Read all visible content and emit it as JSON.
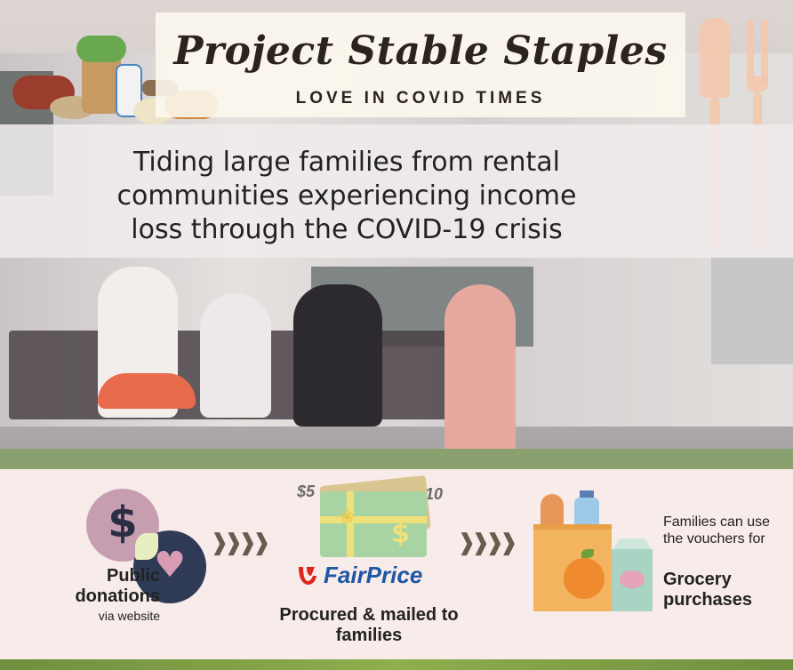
{
  "title": {
    "main": "Project Stable Staples",
    "subtitle": "LOVE IN COVID TIMES"
  },
  "description": "Tiding large families from rental communities experiencing income loss through the COVID-19 crisis",
  "steps": {
    "donation": {
      "label": "Public donations",
      "sublabel": "via website",
      "icons": [
        "dollar-coin-icon",
        "heart-coin-icon"
      ]
    },
    "voucher": {
      "amount_low": "$5",
      "amount_high": "$10",
      "brand": "FairPrice",
      "label": "Procured & mailed to families",
      "icons": [
        "gift-voucher-icon",
        "fairprice-logo-icon"
      ]
    },
    "grocery": {
      "label": "Families can use the vouchers for",
      "highlight": "Grocery purchases",
      "icons": [
        "grocery-bag-icon"
      ]
    }
  },
  "colors": {
    "title_banner": "#fcf8ee",
    "bottom_panel": "#f7ece9",
    "brand_blue": "#1f56a6",
    "brand_red": "#e2231a",
    "utensils": "#f4c7ac"
  }
}
